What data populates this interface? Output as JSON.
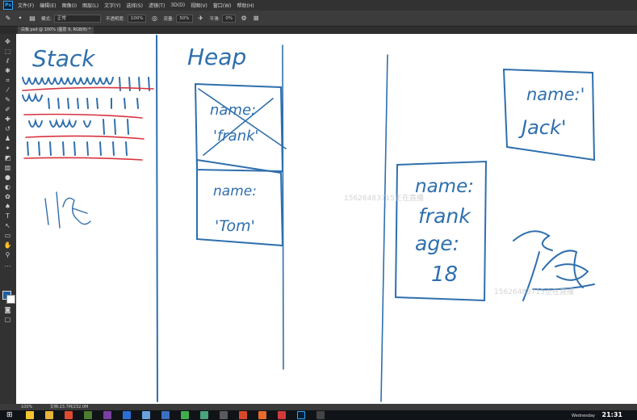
{
  "menubar": {
    "logo": "Ps",
    "items": [
      "文件(F)",
      "编辑(E)",
      "图像(I)",
      "图层(L)",
      "文字(Y)",
      "选择(S)",
      "滤镜(T)",
      "3D(D)",
      "视图(V)",
      "窗口(W)",
      "帮助(H)"
    ]
  },
  "options": {
    "mode_label": "模式:",
    "mode_value": "正常",
    "opacity_label": "不透明度:",
    "opacity_value": "100%",
    "flow_label": "流量:",
    "flow_value": "50%",
    "smooth_label": "平滑:",
    "smooth_value": "0%"
  },
  "tab": {
    "title": "白板.psd @ 100% (图层 9, RGB/8) *"
  },
  "status": {
    "zoom": "100%",
    "doc": "文档:23.7M/232.0M"
  },
  "canvas": {
    "labels": {
      "stack": "Stack",
      "heap": "Heap",
      "ref_name": "name:",
      "ref_frank_crossed": "'frank'",
      "tom_name": "name:",
      "tom_value": "'Tom'",
      "jack_name": "name:'",
      "jack_value": "Jack'",
      "obj_name": "name:",
      "obj_frank": "frank",
      "obj_age": "age:",
      "obj_age_value": "18"
    },
    "watermark": "15626483715正在直播"
  },
  "taskbar": {
    "day": "Wednesday",
    "time": "21:31"
  },
  "colors": {
    "ink_blue": "#2f6fad",
    "ink_red": "#d8343f",
    "ps_blue": "#31a8ff"
  }
}
